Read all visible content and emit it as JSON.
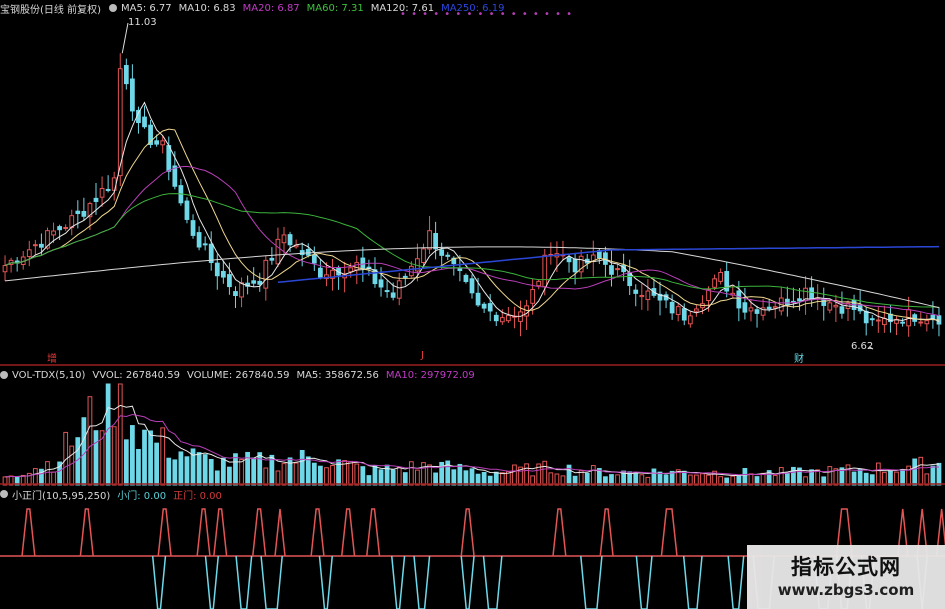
{
  "header_price": {
    "title": "宝钢股份(日线 前复权)",
    "items": [
      {
        "label": "MA5: 6.77",
        "color": "#d8d8d8"
      },
      {
        "label": "MA10: 6.83",
        "color": "#d8d8d8"
      },
      {
        "label": "MA20: 6.87",
        "color": "#c13bc5"
      },
      {
        "label": "MA60: 7.31",
        "color": "#3ec23e"
      },
      {
        "label": "MA120: 7.61",
        "color": "#d8d8d8"
      },
      {
        "label": "MA250: 6.19",
        "color": "#2d47e0"
      }
    ],
    "dots": "• • •   • • •  • •   • • •   • •   • • •"
  },
  "header_volume": {
    "title": "VOL-TDX(5,10)",
    "items": [
      {
        "label": "VVOL: 267840.59",
        "color": "#d8d8d8"
      },
      {
        "label": "VOLUME: 267840.59",
        "color": "#d8d8d8"
      },
      {
        "label": "MA5: 358672.56",
        "color": "#d8d8d8"
      },
      {
        "label": "MA10: 297972.09",
        "color": "#c13bc5"
      }
    ]
  },
  "header_signal": {
    "title": "小正门(10,5,95,250)",
    "items": [
      {
        "label": "小门: 0.00",
        "color": "#5ad0d8"
      },
      {
        "label": "正门: 0.00",
        "color": "#d23a3a"
      }
    ]
  },
  "annotations": {
    "high": "11.03",
    "low": "6.62"
  },
  "events": [
    {
      "label": "增",
      "color": "#e23a3a"
    },
    {
      "label": "J",
      "color": "#e23a3a"
    },
    {
      "label": "财",
      "color": "#6ad7e3"
    }
  ],
  "brand": {
    "title": "指标公式网",
    "url": "www.zbgs3.com"
  },
  "colors": {
    "up": "#e25555",
    "down": "#6ed8e8",
    "ma5": "#e8e8e8",
    "ma10": "#f0d890",
    "ma20": "#b83fb8",
    "ma60": "#3cb43c",
    "ma120": "#d8d8d8",
    "ma250": "#2b47d6",
    "divider": "#9a1f1f"
  },
  "chart_data": [
    {
      "type": "candlestick",
      "title": "宝钢股份(日线 前复权)",
      "ylim": [
        6.2,
        11.6
      ],
      "n_bars": 155,
      "anchors_close": [
        [
          0,
          7.6
        ],
        [
          12,
          8.4
        ],
        [
          18,
          9.0
        ],
        [
          19,
          11.03
        ],
        [
          22,
          9.8
        ],
        [
          26,
          9.5
        ],
        [
          30,
          8.3
        ],
        [
          35,
          7.5
        ],
        [
          38,
          7.2
        ],
        [
          42,
          7.4
        ],
        [
          46,
          8.1
        ],
        [
          52,
          7.5
        ],
        [
          58,
          7.6
        ],
        [
          64,
          7.1
        ],
        [
          70,
          8.1
        ],
        [
          75,
          7.4
        ],
        [
          78,
          6.9
        ],
        [
          82,
          6.8
        ],
        [
          86,
          6.9
        ],
        [
          90,
          7.9
        ],
        [
          94,
          7.6
        ],
        [
          98,
          7.7
        ],
        [
          102,
          7.4
        ],
        [
          108,
          7.0
        ],
        [
          112,
          6.8
        ],
        [
          114,
          7.0
        ],
        [
          118,
          7.4
        ],
        [
          122,
          6.9
        ],
        [
          128,
          7.0
        ],
        [
          132,
          7.2
        ],
        [
          136,
          7.0
        ],
        [
          140,
          6.9
        ],
        [
          143,
          6.62
        ],
        [
          146,
          6.75
        ],
        [
          150,
          6.8
        ],
        [
          154,
          6.77
        ]
      ],
      "high": 11.03,
      "low": 6.62,
      "moving_averages": {
        "MA5": 6.77,
        "MA10": 6.83,
        "MA20": 6.87,
        "MA60": 7.31,
        "MA120": 7.61,
        "MA250": 6.19
      }
    },
    {
      "type": "bar",
      "title": "VOL-TDX(5,10)",
      "ylim": [
        0,
        1300000
      ],
      "anchors_volume": [
        [
          0,
          120000
        ],
        [
          8,
          300000
        ],
        [
          14,
          850000
        ],
        [
          18,
          1200000
        ],
        [
          22,
          700000
        ],
        [
          28,
          450000
        ],
        [
          34,
          280000
        ],
        [
          42,
          300000
        ],
        [
          52,
          350000
        ],
        [
          60,
          180000
        ],
        [
          70,
          250000
        ],
        [
          80,
          160000
        ],
        [
          90,
          220000
        ],
        [
          100,
          160000
        ],
        [
          112,
          170000
        ],
        [
          122,
          150000
        ],
        [
          132,
          160000
        ],
        [
          142,
          200000
        ],
        [
          154,
          267840
        ]
      ],
      "VVOL": 267840.59,
      "VOLUME": 267840.59,
      "MA5": 358672.56,
      "MA10": 297972.09
    },
    {
      "type": "line",
      "title": "小正门(10,5,95,250)",
      "ylim": [
        -1,
        1
      ],
      "up_pulses": [
        [
          9,
          10
        ],
        [
          30,
          31
        ],
        [
          58,
          59
        ],
        [
          72,
          73
        ],
        [
          78,
          79
        ],
        [
          92,
          93
        ],
        [
          100,
          100
        ],
        [
          113,
          114
        ],
        [
          124,
          125
        ],
        [
          133,
          134
        ],
        [
          167,
          168
        ],
        [
          200,
          201
        ],
        [
          217,
          218
        ],
        [
          239,
          241
        ],
        [
          302,
          304
        ],
        [
          324,
          324
        ],
        [
          331,
          331
        ],
        [
          338,
          338
        ]
      ],
      "down_pulses": [
        [
          56,
          57
        ],
        [
          75,
          76
        ],
        [
          86,
          88
        ],
        [
          95,
          99
        ],
        [
          116,
          117
        ],
        [
          142,
          143
        ],
        [
          150,
          152
        ],
        [
          167,
          168
        ],
        [
          175,
          178
        ],
        [
          210,
          214
        ],
        [
          230,
          232
        ],
        [
          247,
          250
        ],
        [
          263,
          265
        ],
        [
          272,
          276
        ],
        [
          294,
          297
        ],
        [
          302,
          304
        ],
        [
          311,
          312
        ],
        [
          331,
          331
        ]
      ],
      "小门": 0.0,
      "正门": 0.0
    }
  ]
}
